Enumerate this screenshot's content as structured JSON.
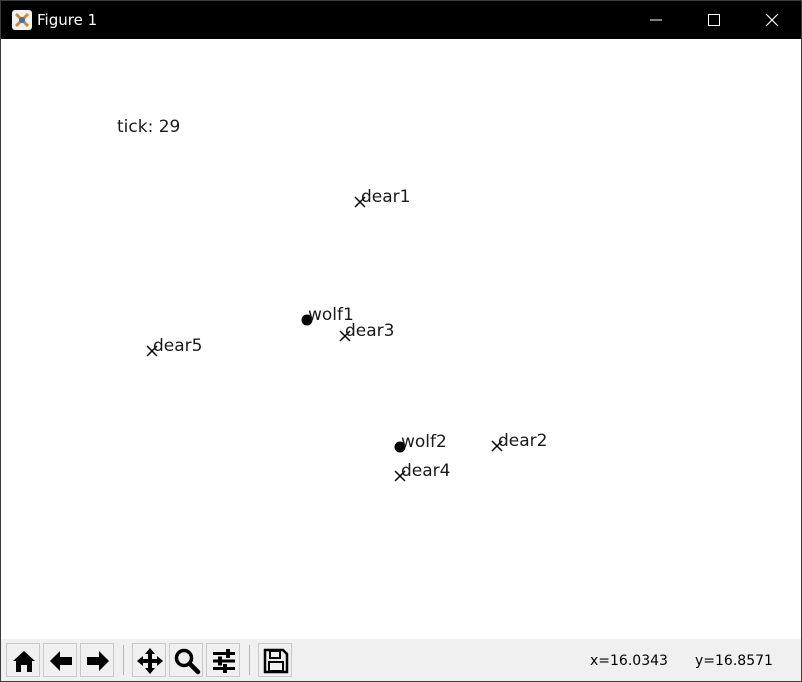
{
  "window": {
    "title": "Figure 1"
  },
  "plot": {
    "tick_text": "tick: 29",
    "wolves": [
      {
        "label": "wolf1"
      },
      {
        "label": "wolf2"
      }
    ],
    "deer": [
      {
        "label": "dear1"
      },
      {
        "label": "dear2"
      },
      {
        "label": "dear3"
      },
      {
        "label": "dear4"
      },
      {
        "label": "dear5"
      }
    ]
  },
  "toolbar": {
    "buttons": [
      {
        "name": "home-button",
        "icon": "home-icon"
      },
      {
        "name": "back-button",
        "icon": "arrow-left-icon"
      },
      {
        "name": "forward-button",
        "icon": "arrow-right-icon"
      },
      {
        "name": "pan-button",
        "icon": "move-icon"
      },
      {
        "name": "zoom-button",
        "icon": "magnifier-icon"
      },
      {
        "name": "configure-subplots-button",
        "icon": "sliders-icon"
      },
      {
        "name": "save-button",
        "icon": "floppy-disk-icon"
      }
    ],
    "coord_x": "x=16.0343",
    "coord_y": "y=16.8571"
  },
  "colors": {
    "titlebar": "#000000",
    "toolbar": "#f0f0f0",
    "marker": "#000000"
  }
}
